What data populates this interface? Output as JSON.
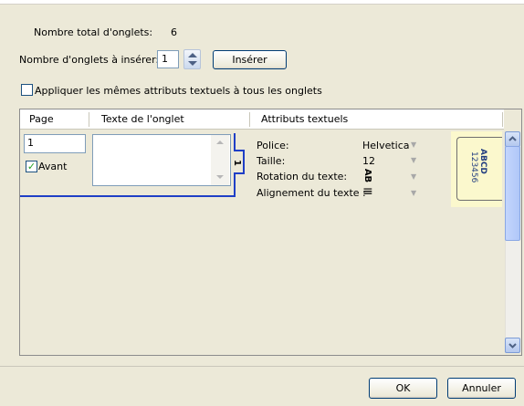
{
  "dialog": {
    "total_tabs_label": "Nombre total d'onglets:",
    "total_tabs_value": "6",
    "insert_count_label": "Nombre d'onglets à insérer:",
    "insert_count_value": "1",
    "insert_button": "Insérer",
    "apply_same_label": "Appliquer les mêmes attributs textuels à tous les onglets",
    "apply_same_checked": false
  },
  "grid": {
    "columns": [
      "Page",
      "Texte de l'onglet",
      "Attributs textuels"
    ],
    "row": {
      "page_value": "1",
      "front_label": "Avant",
      "front_checked": true,
      "tab_text": "",
      "tab_marker": "1",
      "attributes": [
        {
          "label": "Police:",
          "value": "Helvetica"
        },
        {
          "label": "Taille:",
          "value": "12"
        },
        {
          "label": "Rotation du texte:",
          "value": "AB"
        },
        {
          "label": "Alignement du texte :",
          "value": "≡"
        }
      ],
      "preview_text_1": "ABCD",
      "preview_text_2": "123456"
    }
  },
  "footer": {
    "ok_label": "OK",
    "cancel_label": "Annuler"
  },
  "colors": {
    "accent_blue": "#1f3fc6",
    "checkbox_green": "#21a121",
    "tab_preview_bg": "#fbf8cd"
  }
}
